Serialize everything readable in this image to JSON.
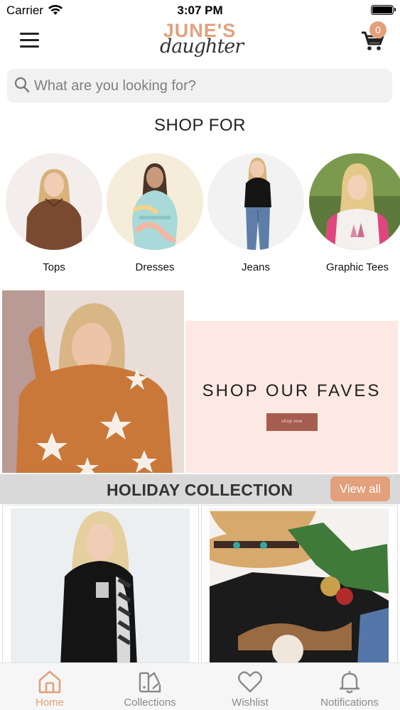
{
  "status_bar": {
    "carrier": "Carrier",
    "time": "3:07 PM"
  },
  "header": {
    "logo_top": "JUNE'S",
    "logo_bottom": "daughter",
    "cart_count": "0"
  },
  "search": {
    "placeholder": "What are you looking for?"
  },
  "shop_for": {
    "title": "SHOP FOR",
    "categories": [
      {
        "label": "Tops"
      },
      {
        "label": "Dresses"
      },
      {
        "label": "Jeans"
      },
      {
        "label": "Graphic Tees"
      }
    ]
  },
  "banner": {
    "heading": "SHOP OUR FAVES",
    "button_label": "shop now"
  },
  "holiday": {
    "title": "HOLIDAY COLLECTION",
    "view_all_label": "View all"
  },
  "tabs": [
    {
      "label": "Home",
      "icon": "home-icon",
      "active": true
    },
    {
      "label": "Collections",
      "icon": "collections-icon",
      "active": false
    },
    {
      "label": "Wishlist",
      "icon": "heart-icon",
      "active": false
    },
    {
      "label": "Notifications",
      "icon": "bell-icon",
      "active": false
    }
  ],
  "colors": {
    "accent": "#e2a07b",
    "banner_bg": "#fde9e3",
    "banner_button": "#a55d4f",
    "holiday_bar": "#d9d9d9",
    "tab_inactive": "#8a8a8a"
  }
}
